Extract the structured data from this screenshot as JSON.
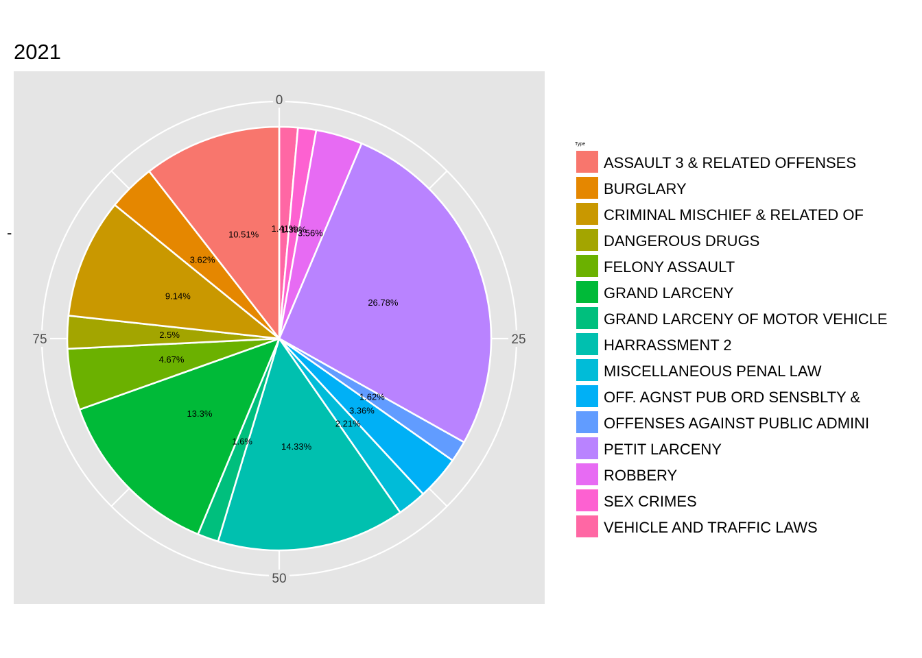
{
  "chart_data": {
    "type": "pie",
    "title": "2021",
    "ylabel": "-",
    "legend_title": "Type",
    "legend_position": "right",
    "theta_ticks": [
      "0",
      "25",
      "50",
      "75"
    ],
    "theta_tick_values": [
      0,
      25,
      50,
      75
    ],
    "theta_range": [
      0,
      100
    ],
    "grid": true,
    "categories": [
      "ASSAULT 3 & RELATED OFFENSES",
      "BURGLARY",
      "CRIMINAL MISCHIEF & RELATED OF",
      "DANGEROUS DRUGS",
      "FELONY ASSAULT",
      "GRAND LARCENY",
      "GRAND LARCENY OF MOTOR VEHICLE",
      "HARRASSMENT 2",
      "MISCELLANEOUS PENAL LAW",
      "OFF. AGNST PUB ORD SENSBLTY &",
      "OFFENSES AGAINST PUBLIC ADMINI",
      "PETIT LARCENY",
      "ROBBERY",
      "SEX CRIMES",
      "VEHICLE AND TRAFFIC LAWS"
    ],
    "colors": [
      "#F8766D",
      "#E58700",
      "#C99800",
      "#A3A500",
      "#6BB100",
      "#00BA38",
      "#00BF7D",
      "#00C0AF",
      "#00BCD8",
      "#00B0F6",
      "#619CFF",
      "#B983FF",
      "#E76BF3",
      "#FD61D1",
      "#FF67A4"
    ],
    "clockwise_order": [
      14,
      13,
      12,
      11,
      10,
      9,
      8,
      7,
      6,
      5,
      4,
      3,
      2,
      1,
      0
    ],
    "values": [
      10.51,
      3.62,
      9.14,
      2.5,
      4.67,
      13.3,
      1.6,
      14.33,
      2.21,
      3.36,
      1.62,
      26.78,
      3.56,
      1.39,
      1.41
    ],
    "labels": [
      "10.51%",
      "3.62%",
      "9.14%",
      "2.5%",
      "4.67%",
      "13.3%",
      "1.6%",
      "14.33%",
      "2.21%",
      "3.36%",
      "1.62%",
      "26.78%",
      "3.56%",
      "1.39%",
      "1.41%"
    ],
    "panel_background": "#E5E5E5",
    "grid_color": "#FFFFFF"
  }
}
